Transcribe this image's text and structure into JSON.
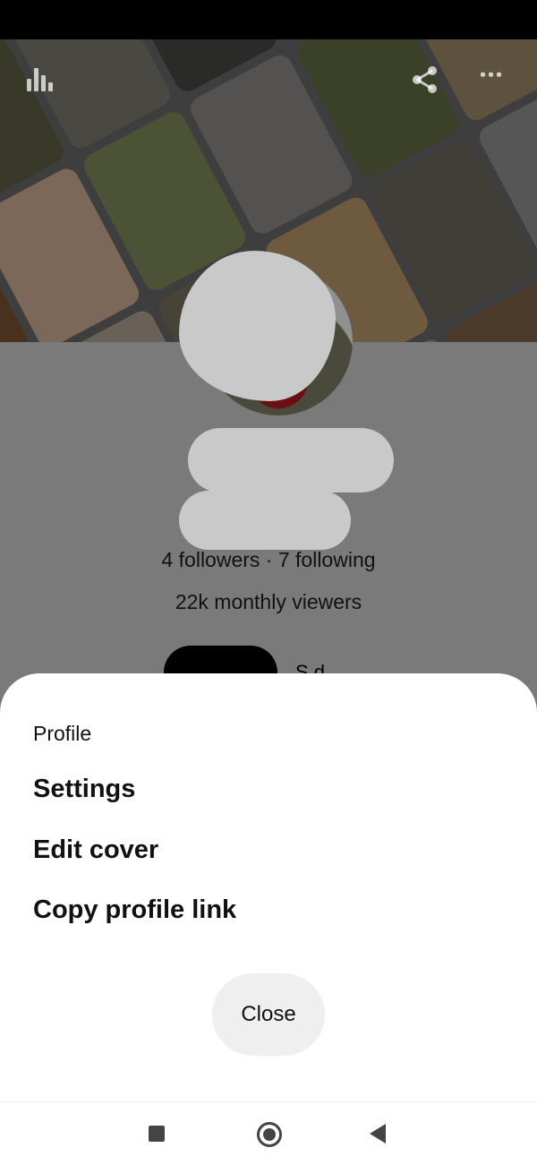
{
  "profile": {
    "followers_text": "4 followers · 7 following",
    "viewers_text": "22k monthly viewers",
    "tab_right_label": "S    d"
  },
  "menu": {
    "title": "Profile",
    "items": [
      {
        "label": "Settings"
      },
      {
        "label": "Edit cover"
      },
      {
        "label": "Copy profile link"
      }
    ],
    "close_label": "Close"
  },
  "icons": {
    "stats": "stats-icon",
    "share": "share-icon",
    "more": "more-icon",
    "nav_recent": "square-icon",
    "nav_home": "home-circle-icon",
    "nav_back": "back-triangle-icon"
  },
  "colors": {
    "overlay": "#7a7a7a",
    "sheet": "#ffffff",
    "close_button": "#efefef",
    "text": "#111111"
  }
}
